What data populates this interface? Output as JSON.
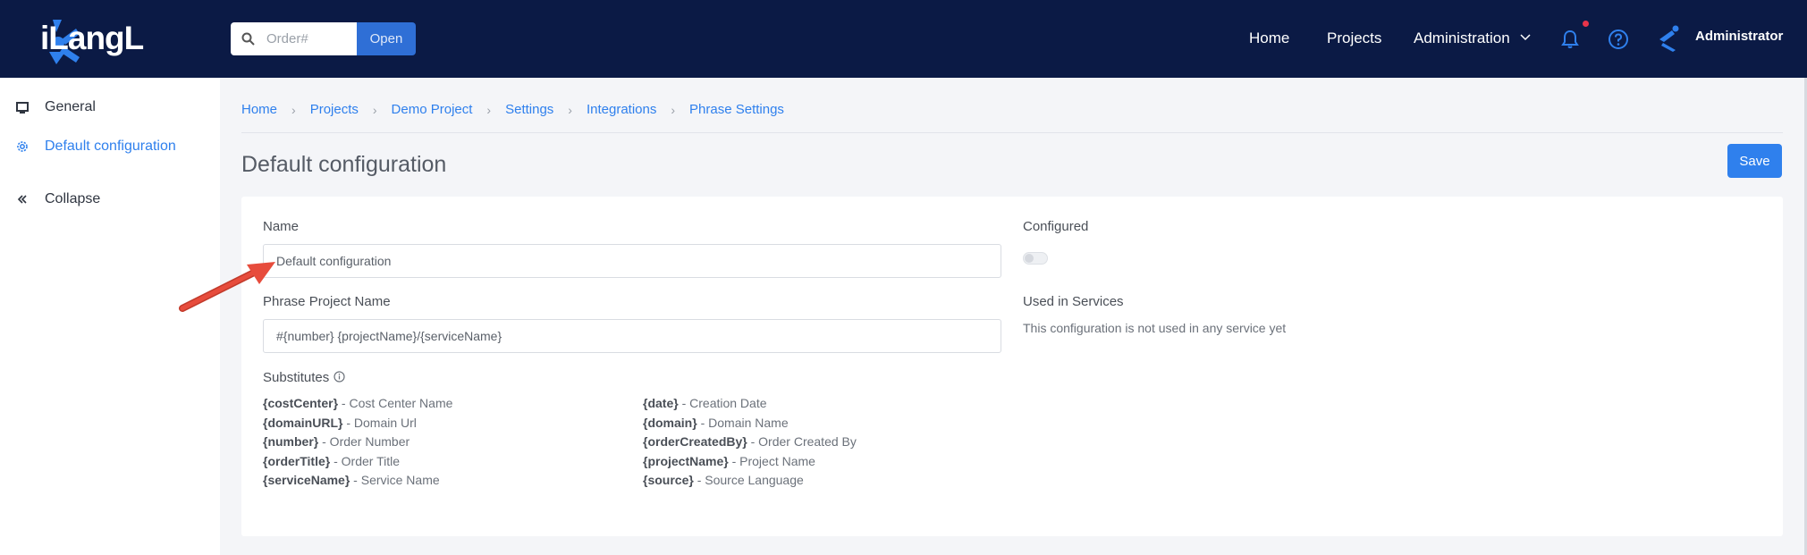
{
  "colors": {
    "topbar": "#0b1a45",
    "accent": "#2f80ed",
    "notification_dot": "#e8344a",
    "annotation_arrow": "#e74c3c"
  },
  "header": {
    "logo_text": "iLangL",
    "search": {
      "placeholder": "Order#",
      "value": "",
      "open_label": "Open",
      "icon": "search-icon"
    },
    "nav": {
      "home": "Home",
      "projects": "Projects",
      "administration": "Administration"
    },
    "icons": [
      "bell-icon",
      "help-icon",
      "user-icon",
      "chevron-down-icon"
    ],
    "user_name": "Administrator"
  },
  "sidebar": {
    "items": [
      {
        "label": "General",
        "icon": "monitor-icon"
      },
      {
        "label": "Default configuration",
        "icon": "gear-icon",
        "active": true
      },
      {
        "label": "Collapse",
        "icon": "double-chevron-left-icon"
      }
    ]
  },
  "breadcrumb": [
    "Home",
    "Projects",
    "Demo Project",
    "Settings",
    "Integrations",
    "Phrase Settings"
  ],
  "page": {
    "title": "Default configuration",
    "save_label": "Save"
  },
  "form": {
    "name_label": "Name",
    "name_value": "Default configuration",
    "phrase_project_label": "Phrase Project Name",
    "phrase_project_value": "#{number} {projectName}/{serviceName}",
    "configured_label": "Configured",
    "configured_on": false,
    "used_in_services_label": "Used in Services",
    "used_in_services_text": "This configuration is not used in any service yet",
    "substitutes_label": "Substitutes",
    "substitutes_left": [
      {
        "key": "{costCenter}",
        "desc": " - Cost Center Name"
      },
      {
        "key": "{domainURL}",
        "desc": " - Domain Url"
      },
      {
        "key": "{number}",
        "desc": " - Order Number"
      },
      {
        "key": "{orderTitle}",
        "desc": " - Order Title"
      },
      {
        "key": "{serviceName}",
        "desc": " - Service Name"
      }
    ],
    "substitutes_right": [
      {
        "key": "{date}",
        "desc": " - Creation Date"
      },
      {
        "key": "{domain}",
        "desc": " - Domain Name"
      },
      {
        "key": "{orderCreatedBy}",
        "desc": " - Order Created By"
      },
      {
        "key": "{projectName}",
        "desc": " - Project Name"
      },
      {
        "key": "{source}",
        "desc": " - Source Language"
      }
    ]
  }
}
